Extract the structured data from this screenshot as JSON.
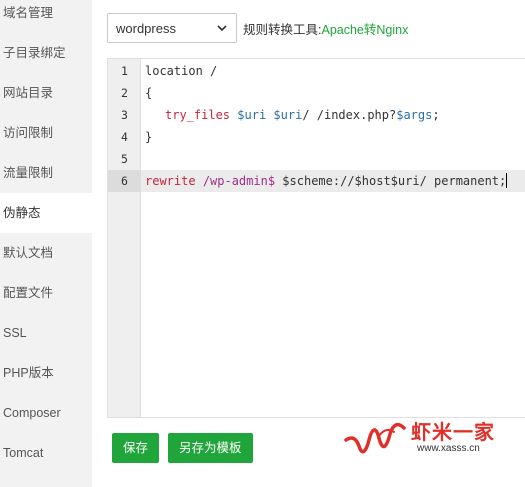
{
  "sidebar": {
    "items": [
      {
        "label": "域名管理"
      },
      {
        "label": "子目录绑定"
      },
      {
        "label": "网站目录"
      },
      {
        "label": "访问限制"
      },
      {
        "label": "流量限制"
      },
      {
        "label": "伪静态"
      },
      {
        "label": "默认文档"
      },
      {
        "label": "配置文件"
      },
      {
        "label": "SSL"
      },
      {
        "label": "PHP版本"
      },
      {
        "label": "Composer"
      },
      {
        "label": "Tomcat"
      }
    ],
    "active_index": 5
  },
  "toolbar": {
    "select_value": "wordpress",
    "tool_label": "规则转换工具:",
    "tool_link": "Apache转Nginx"
  },
  "editor": {
    "active_line": 6,
    "lines": [
      {
        "num": "1"
      },
      {
        "num": "2"
      },
      {
        "num": "3"
      },
      {
        "num": "4"
      },
      {
        "num": "5"
      },
      {
        "num": "6"
      }
    ],
    "tokens": {
      "l1": "location /",
      "l2": "{",
      "l3_fn": "try_files",
      "l3_v1": "$uri",
      "l3_v2": "$uri",
      "l3_p1": "/ /index.php?",
      "l3_v3": "$args",
      "l3_end": ";",
      "l4": "}",
      "l6_kw": "rewrite",
      "l6_re": "/wp-admin$",
      "l6_rest": "$scheme://$host$uri/ permanent;"
    }
  },
  "buttons": {
    "save": "保存",
    "save_template": "另存为模板"
  },
  "watermark": {
    "name": "虾米一家",
    "url": "www.xasss.cn",
    "color": "#e0302a"
  },
  "colors": {
    "accent": "#20a53a"
  }
}
